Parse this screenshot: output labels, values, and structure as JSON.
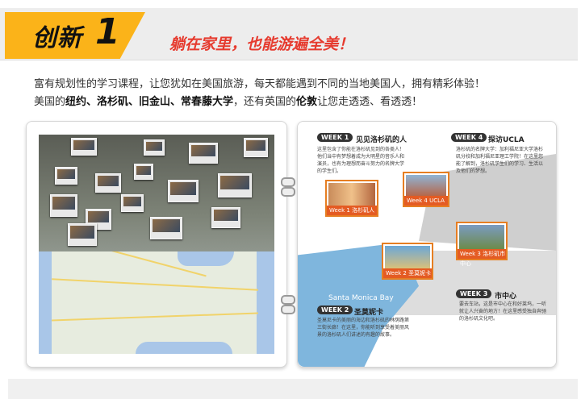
{
  "banner": {
    "badge_label": "创新",
    "badge_number": "1",
    "headline": "躺在家里，也能游遍全美！"
  },
  "intro": {
    "line1": "富有规划性的学习课程，让您犹如在美国旅游，每天都能遇到不同的当地美国人，拥有精彩体验！",
    "line2_prefix": "美国的",
    "line2_cities": "纽约、洛杉矶、旧金山、常春藤大学",
    "line2_mid": "，还有英国的",
    "line2_london": "伦敦",
    "line2_suffix": "让您走透透、看透透！"
  },
  "la_map": {
    "sea_label": "Santa Monica Bay",
    "weeks": [
      {
        "tag": "WEEK 1",
        "title": "见见洛杉矶的人",
        "text": "这里包含了你能在洛杉矶见到的各类人！他们当中有梦想着成为大明星的音乐人和演员，也有为理想而奋斗努力的名牌大学的学生们。",
        "photo_label": "Week 1  洛杉矶人"
      },
      {
        "tag": "WEEK 2",
        "title": "圣莫妮卡",
        "text": "圣莫尼卡的美丽的海边和洛杉矶的林荫路第三街长廊！在这里，你能听到享受着美丽风景的洛杉矶人们讲述的有趣的故事。",
        "photo_label": "Week 2  圣莫妮卡"
      },
      {
        "tag": "WEEK 3",
        "title": "市中心",
        "text": "要去车站，这是市中心在和好莱坞，一听就让人兴奋的地方！在这里感受独自奔驰的洛杉矶文化吧。",
        "photo_label": "Week 3  洛杉矶市中心"
      },
      {
        "tag": "WEEK 4",
        "title": "探访UCLA",
        "text": "洛杉矶的名牌大学：加利福尼亚大学洛杉矶分校和加利福尼亚理工学院！在这里您能了解到，洛杉矶学生们的学习、生活以及他们的梦想。",
        "photo_label": "Week 4  UCLA"
      }
    ],
    "hollywood_sign": "HOLLYWOOD"
  },
  "colors": {
    "badge": "#fbb319",
    "headline": "#e63a2e",
    "week_tag": "#333333",
    "photo_frame": "#e67e22",
    "sea": "#7fb6dd"
  }
}
